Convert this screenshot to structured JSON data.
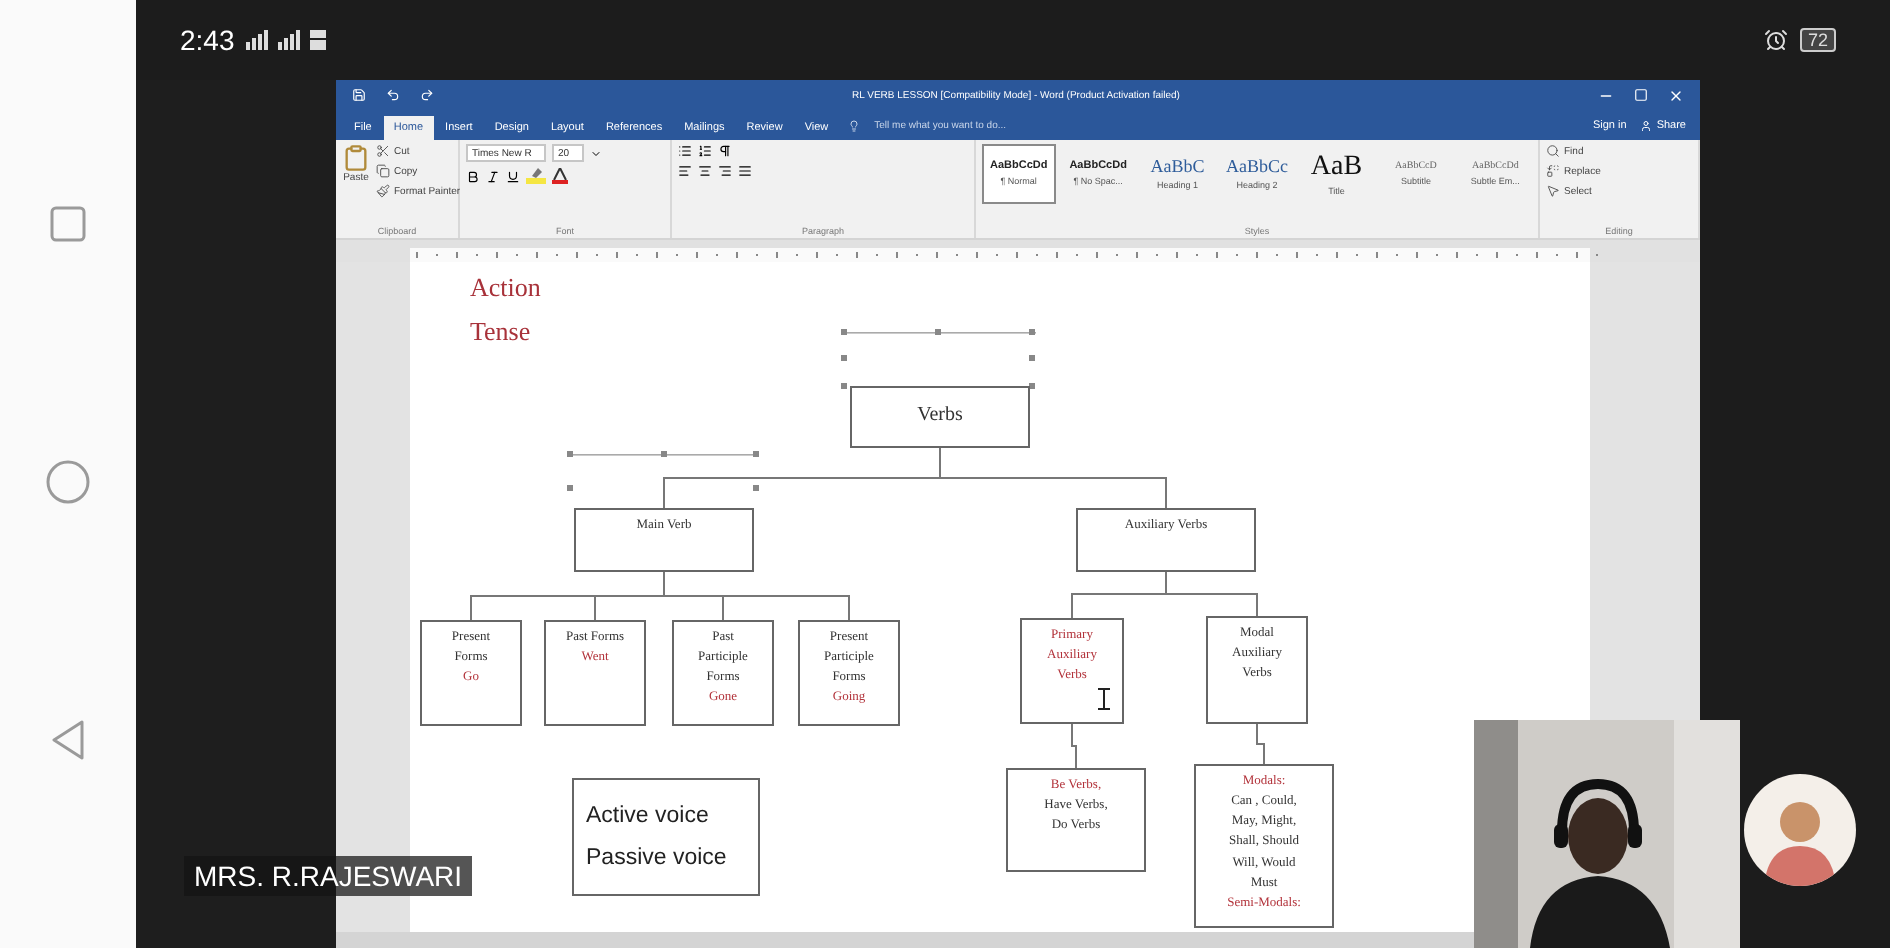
{
  "phone_status": {
    "time": "2:43",
    "battery": "72"
  },
  "word": {
    "title": "RL VERB LESSON [Compatibility Mode] - Word (Product Activation failed)",
    "tabs": [
      {
        "label": "File",
        "selected": false
      },
      {
        "label": "Home",
        "selected": true
      },
      {
        "label": "Insert",
        "selected": false
      },
      {
        "label": "Design",
        "selected": false
      },
      {
        "label": "Layout",
        "selected": false
      },
      {
        "label": "References",
        "selected": false
      },
      {
        "label": "Mailings",
        "selected": false
      },
      {
        "label": "Review",
        "selected": false
      },
      {
        "label": "View",
        "selected": false
      }
    ],
    "tell_me": "Tell me what you want to do...",
    "sign_in": "Sign in",
    "share": "Share",
    "ribbon": {
      "paste": "Paste",
      "clipboard_items": [
        "Cut",
        "Copy",
        "Format Painter"
      ],
      "font_name": "Times New R",
      "font_size": "20",
      "styles": [
        {
          "sample": "AaBbCcDd",
          "name": "¶ Normal",
          "kind": "normal",
          "selected": true
        },
        {
          "sample": "AaBbCcDd",
          "name": "¶ No Spac...",
          "kind": "normal",
          "selected": false
        },
        {
          "sample": "AaBbC",
          "name": "Heading 1",
          "kind": "heading",
          "selected": false
        },
        {
          "sample": "AaBbCc",
          "name": "Heading 2",
          "kind": "heading",
          "selected": false
        },
        {
          "sample": "AaB",
          "name": "Title",
          "kind": "title",
          "selected": false
        },
        {
          "sample": "AaBbCcD",
          "name": "Subtitle",
          "kind": "subtle",
          "selected": false
        },
        {
          "sample": "AaBbCcDd",
          "name": "Subtle Em...",
          "kind": "subtle",
          "selected": false
        }
      ],
      "editing": [
        "Find",
        "Replace",
        "Select"
      ],
      "groups": [
        "Clipboard",
        "Font",
        "Paragraph",
        "Styles",
        "Editing"
      ]
    },
    "document": {
      "headings": [
        "Action",
        "Tense"
      ],
      "diagram": {
        "lines": [
          {
            "text": "Verbs",
            "color": "#333333"
          }
        ],
        "children": [
          {
            "lines": [
              {
                "text": "Main Verb",
                "color": "#333333"
              }
            ],
            "children": [
              {
                "lines": [
                  {
                    "text": "Present",
                    "color": "#333333"
                  },
                  {
                    "text": "Forms",
                    "color": "#333333"
                  },
                  {
                    "text": "Go",
                    "color": "#b2323a"
                  }
                ]
              },
              {
                "lines": [
                  {
                    "text": "Past Forms",
                    "color": "#333333"
                  },
                  {
                    "text": "Went",
                    "color": "#b2323a"
                  }
                ]
              },
              {
                "lines": [
                  {
                    "text": "Past",
                    "color": "#333333"
                  },
                  {
                    "text": "Participle",
                    "color": "#333333"
                  },
                  {
                    "text": "Forms",
                    "color": "#333333"
                  },
                  {
                    "text": "Gone",
                    "color": "#b2323a"
                  }
                ]
              },
              {
                "lines": [
                  {
                    "text": "Present",
                    "color": "#333333"
                  },
                  {
                    "text": "Participle",
                    "color": "#333333"
                  },
                  {
                    "text": "Forms",
                    "color": "#333333"
                  },
                  {
                    "text": "Going",
                    "color": "#b2323a"
                  }
                ]
              }
            ]
          },
          {
            "lines": [
              {
                "text": "Auxiliary Verbs",
                "color": "#333333"
              }
            ],
            "children": [
              {
                "lines": [
                  {
                    "text": "Primary",
                    "color": "#b2323a"
                  },
                  {
                    "text": "Auxiliary",
                    "color": "#b2323a"
                  },
                  {
                    "text": "Verbs",
                    "color": "#b2323a"
                  }
                ],
                "children": [
                  {
                    "lines": [
                      {
                        "text": "Be Verbs,",
                        "color": "#b2323a"
                      },
                      {
                        "text": "Have Verbs,",
                        "color": "#333333"
                      },
                      {
                        "text": "Do Verbs",
                        "color": "#333333"
                      }
                    ]
                  }
                ]
              },
              {
                "lines": [
                  {
                    "text": "Modal",
                    "color": "#333333"
                  },
                  {
                    "text": "Auxiliary",
                    "color": "#333333"
                  },
                  {
                    "text": "Verbs",
                    "color": "#333333"
                  }
                ],
                "children": [
                  {
                    "lines": [
                      {
                        "text": "Modals:",
                        "color": "#b2323a"
                      },
                      {
                        "text": "Can , Could,",
                        "color": "#333333"
                      },
                      {
                        "text": "May, Might,",
                        "color": "#333333"
                      },
                      {
                        "text": "Shall, Should",
                        "color": "#333333"
                      },
                      {
                        "text": "Will, Would",
                        "color": "#333333"
                      },
                      {
                        "text": "Must",
                        "color": "#333333"
                      },
                      {
                        "text": "Semi-Modals:",
                        "color": "#b2323a"
                      }
                    ]
                  }
                ]
              }
            ]
          }
        ]
      },
      "voice_box": [
        "Active voice",
        "Passive voice"
      ]
    }
  },
  "presenter_name": "MRS. R.RAJESWARI"
}
